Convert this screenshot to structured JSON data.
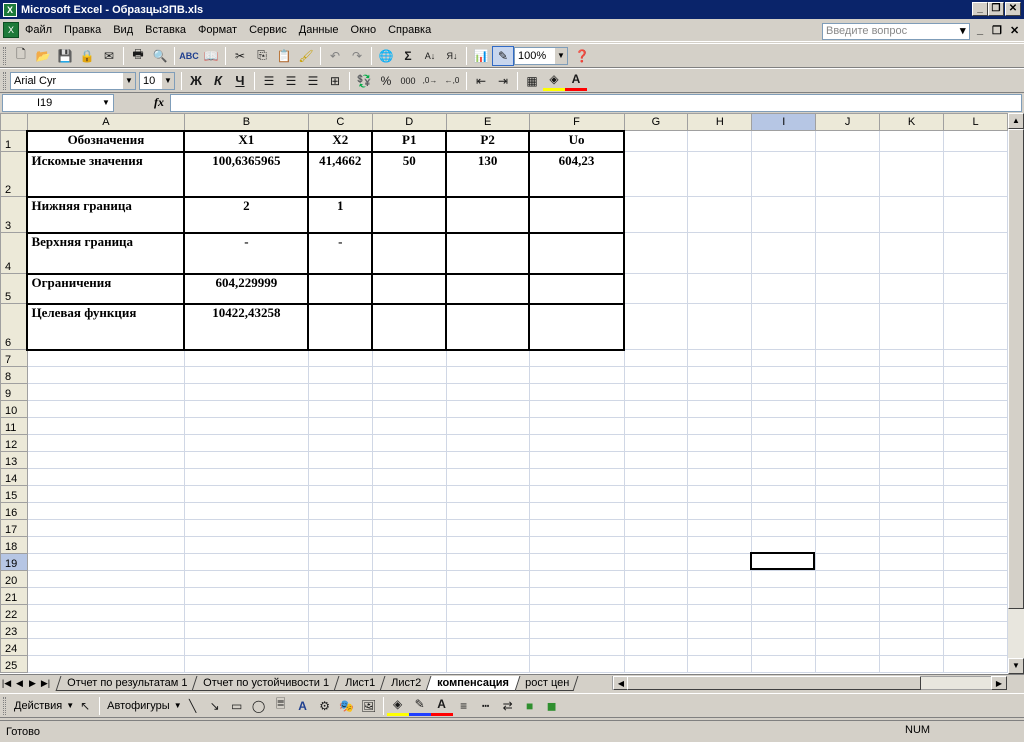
{
  "window": {
    "title": "Microsoft Excel - ОбразцыЗПВ.xls"
  },
  "menu": {
    "items": [
      "Файл",
      "Правка",
      "Вид",
      "Вставка",
      "Формат",
      "Сервис",
      "Данные",
      "Окно",
      "Справка"
    ],
    "help_placeholder": "Введите вопрос"
  },
  "toolbar": {
    "zoom": "100%"
  },
  "format_toolbar": {
    "font": "Arial Cyr",
    "size": "10",
    "bold": "Ж",
    "italic": "К",
    "underline": "Ч"
  },
  "formula_bar": {
    "name_box": "I19",
    "fx": "fx",
    "value": ""
  },
  "columns": [
    "A",
    "B",
    "C",
    "D",
    "E",
    "F",
    "G",
    "H",
    "I",
    "J",
    "K",
    "L"
  ],
  "selected": {
    "column": "I",
    "row": "19"
  },
  "rows": [
    "1",
    "2",
    "3",
    "4",
    "5",
    "6",
    "7",
    "8",
    "9",
    "10",
    "11",
    "12",
    "13",
    "14",
    "15",
    "16",
    "17",
    "18",
    "19",
    "20",
    "21",
    "22",
    "23",
    "24",
    "25"
  ],
  "table": {
    "header": [
      "Обозначения",
      "X1",
      "X2",
      "P1",
      "P2",
      "Uo"
    ],
    "rows": [
      [
        "Искомые значения",
        "100,6365965",
        "41,4662",
        "50",
        "130",
        "604,23"
      ],
      [
        "Нижняя граница",
        "2",
        "1",
        "",
        "",
        ""
      ],
      [
        "Верхняя граница",
        "-",
        "-",
        "",
        "",
        ""
      ],
      [
        "Ограничения",
        "604,229999",
        "",
        "",
        "",
        ""
      ],
      [
        "Целевая функция",
        "10422,43258",
        "",
        "",
        "",
        ""
      ]
    ]
  },
  "sheet_tabs": [
    "Отчет по результатам 1",
    "Отчет по устойчивости 1",
    "Лист1",
    "Лист2",
    "компенсация",
    "рост цен"
  ],
  "active_tab": "компенсация",
  "drawing_toolbar": {
    "actions": "Действия",
    "autoshapes": "Автофигуры"
  },
  "status": {
    "text": "Готово",
    "num": "NUM"
  },
  "colors": {
    "titlebar": "#0a246a",
    "chrome": "#d4d0c8",
    "selection_header": "#b6c6e4"
  }
}
